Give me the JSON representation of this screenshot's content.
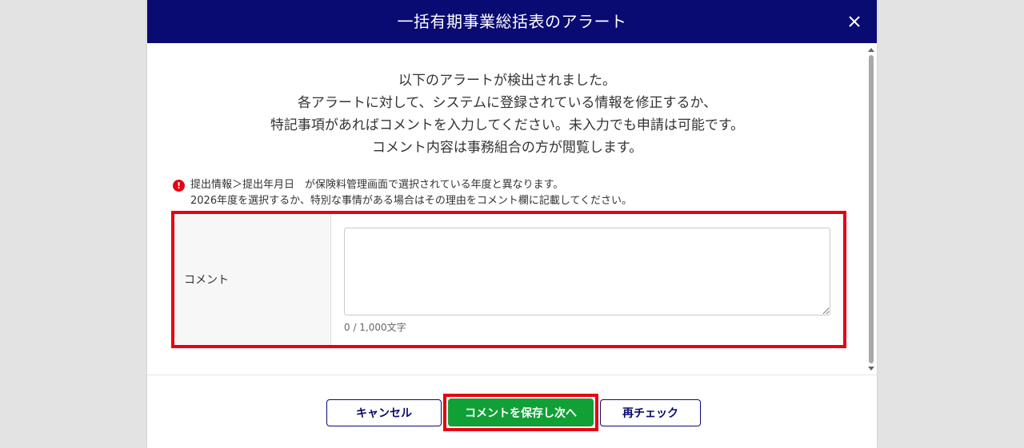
{
  "dialog": {
    "title": "一括有期事業総括表のアラート",
    "close_icon": "close-icon"
  },
  "intro": {
    "lines": [
      "以下のアラートが検出されました。",
      "各アラートに対して、システムに登録されている情報を修正するか、",
      "特記事項があればコメントを入力してください。未入力でも申請は可能です。",
      "コメント内容は事務組合の方が閲覧します。"
    ]
  },
  "alert": {
    "icon": "exclamation-circle-icon",
    "icon_glyph": "!",
    "line1": "提出情報＞提出年月日　が保険料管理画面で選択されている年度と異なります。",
    "line2": "2026年度を選択するか、特別な事情がある場合はその理由をコメント欄に記載してください。"
  },
  "comment": {
    "label": "コメント",
    "value": "",
    "counter": "0 / 1,000文字"
  },
  "footer": {
    "cancel_label": "キャンセル",
    "save_label": "コメントを保存し次へ",
    "recheck_label": "再チェック"
  },
  "colors": {
    "header_bg": "#0a0a73",
    "highlight": "#e60012",
    "save_button": "#11a036",
    "alert_icon": "#e60012"
  }
}
